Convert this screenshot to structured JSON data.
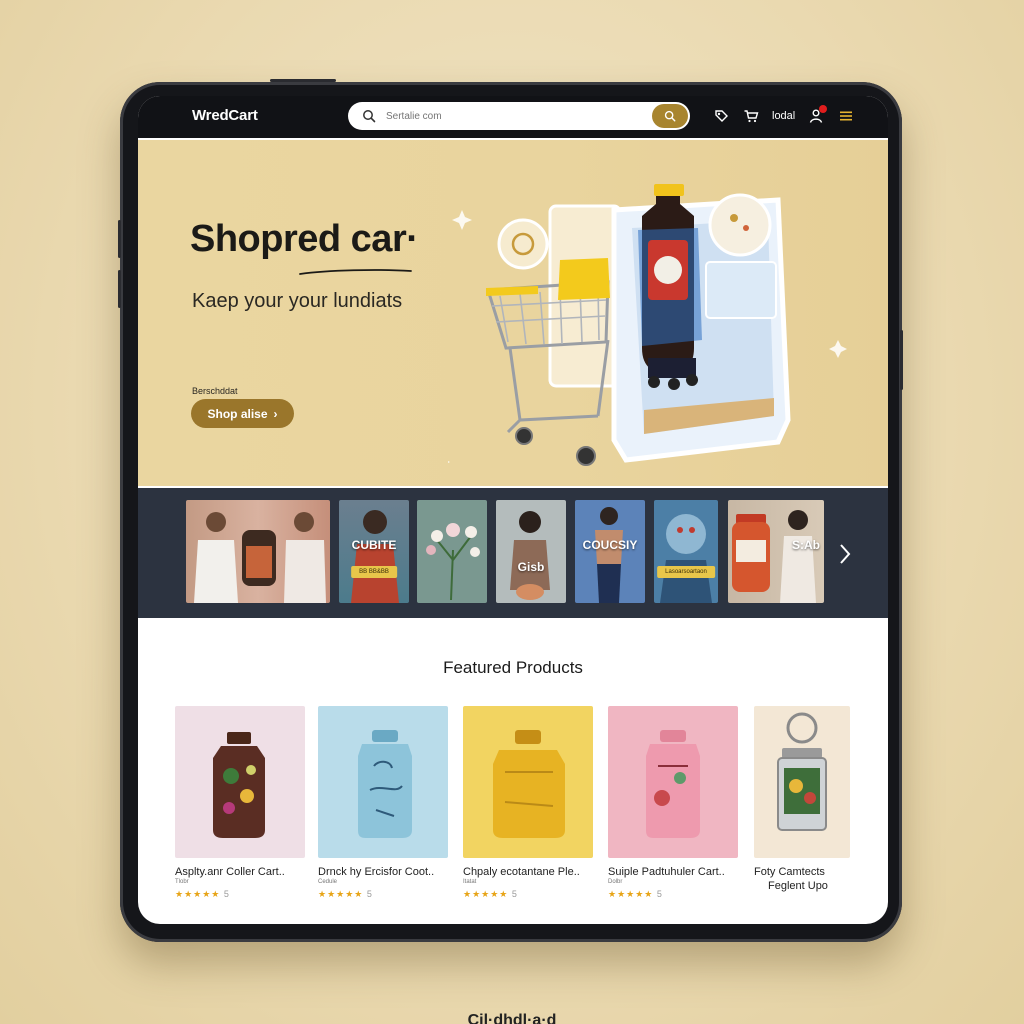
{
  "header": {
    "brand": "WredCart",
    "search_placeholder": "Sertalie com",
    "account_label": "lodal"
  },
  "hero": {
    "title": "Shopred car·",
    "subtitle": "Kaep your your lundiats",
    "tag": "Berschddat",
    "cta_label": "Shop alise",
    "cta_arrow": "›",
    "slide_count": 4
  },
  "categories": [
    {
      "label": "",
      "pill": ""
    },
    {
      "label": "CUBITE",
      "pill": "BB BB&BB"
    },
    {
      "label": "",
      "pill": ""
    },
    {
      "label": "Gisb",
      "pill": ""
    },
    {
      "label": "COUCSIY",
      "pill": ""
    },
    {
      "label": "",
      "pill": "Lasoarsoartaon"
    },
    {
      "label": "",
      "pill": ""
    },
    {
      "label": "S:Ab",
      "pill": ""
    }
  ],
  "featured": {
    "title": "Featured Products",
    "products": [
      {
        "name": "Asplty.anr Coller Cart..",
        "sub": "Tlobr",
        "stars": "★★★★★",
        "rating_suffix": "5",
        "bg": "#efdfe6"
      },
      {
        "name": "Drnck hy Ercisfor Coot..",
        "sub": "Cedule",
        "stars": "★★★★★",
        "rating_suffix": "5",
        "bg": "#b9dcea"
      },
      {
        "name": "Chpaly ecotantane Ple..",
        "sub": "Itatat",
        "stars": "★★★★★",
        "rating_suffix": "5",
        "bg": "#f2d461"
      },
      {
        "name": "Suiple Padtuhuler Cart..",
        "sub": "Dolbr",
        "stars": "★★★★★",
        "rating_suffix": "5",
        "bg": "#f0b6c2"
      },
      {
        "name": "Foty Camtects",
        "sub": "Feglent Upo",
        "stars": "",
        "rating_suffix": "",
        "bg": "#f3e7d5"
      }
    ]
  },
  "footer_caption": "Cil·dhdl·a·d",
  "colors": {
    "accent": "#9a762b",
    "topbar": "#111216",
    "strip": "#2c3340",
    "hero_bg": "#ead6a0",
    "star": "#e7a417",
    "notification": "#e11d1d"
  }
}
